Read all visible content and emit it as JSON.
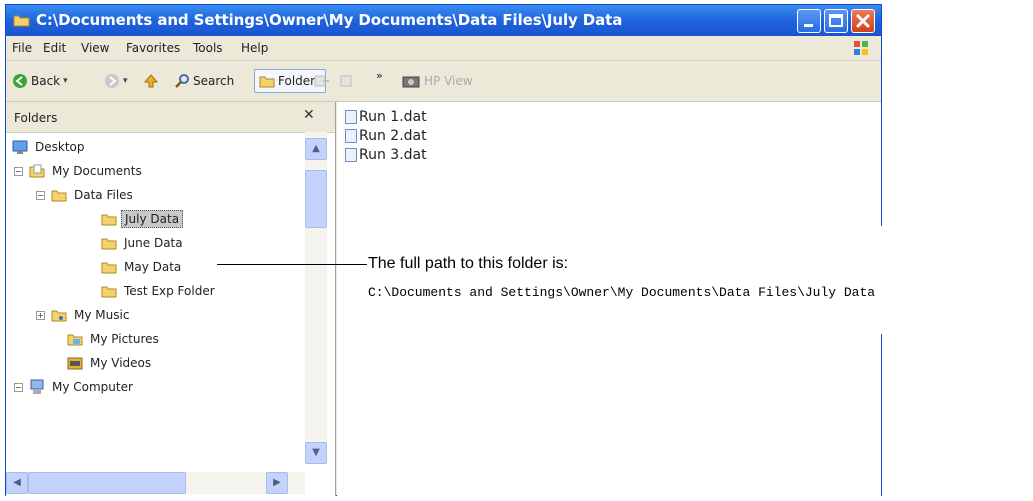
{
  "window": {
    "title": "C:\\Documents and Settings\\Owner\\My Documents\\Data Files\\July Data"
  },
  "menu": [
    "File",
    "Edit",
    "View",
    "Favorites",
    "Tools",
    "Help"
  ],
  "toolbar": {
    "back": "Back",
    "search": "Search",
    "folders": "Folders",
    "hp_view": "HP View",
    "more": "»"
  },
  "folders_pane": {
    "title": "Folders",
    "tree": [
      {
        "label": "Desktop",
        "icon": "desktop-icon"
      },
      {
        "label": "My Documents",
        "icon": "documents-folder-icon",
        "expander": "−"
      },
      {
        "label": "Data Files",
        "icon": "folder-open-icon",
        "expander": "−"
      },
      {
        "label": "July Data",
        "icon": "folder-icon",
        "selected": true
      },
      {
        "label": "June Data",
        "icon": "folder-icon"
      },
      {
        "label": "May Data",
        "icon": "folder-icon"
      },
      {
        "label": "Test Exp Folder",
        "icon": "folder-icon"
      },
      {
        "label": "My Music",
        "icon": "music-folder-icon",
        "expander": "+"
      },
      {
        "label": "My Pictures",
        "icon": "pictures-folder-icon"
      },
      {
        "label": "My Videos",
        "icon": "videos-folder-icon"
      },
      {
        "label": "My Computer",
        "icon": "computer-icon",
        "expander": "−"
      }
    ]
  },
  "files": [
    "Run 1.dat",
    "Run 2.dat",
    "Run 3.dat"
  ],
  "callout": {
    "text": "The full path to this folder is:",
    "path": "C:\\Documents and Settings\\Owner\\My Documents\\Data Files\\July Data"
  },
  "colors": {
    "titlebar": "#1f63dd",
    "close_button": "#d3401c",
    "selection": "#c9c9c9",
    "scrollbar": "#c3d3fd"
  }
}
